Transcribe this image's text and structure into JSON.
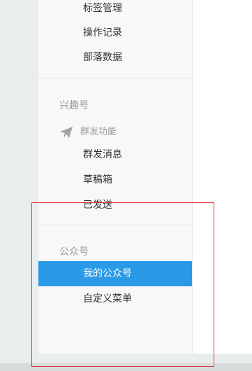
{
  "sidebar": {
    "top_items": [
      {
        "label": "标签管理"
      },
      {
        "label": "操作记录"
      },
      {
        "label": "部落数据"
      }
    ],
    "interest_section": {
      "title": "兴趣号",
      "subgroup": {
        "icon": "paper-plane-icon",
        "label": "群发功能"
      },
      "items": [
        {
          "label": "群发消息"
        },
        {
          "label": "草稿箱"
        },
        {
          "label": "已发送"
        }
      ]
    },
    "public_section": {
      "title": "公众号",
      "items": [
        {
          "label": "我的公众号",
          "active": true
        },
        {
          "label": "自定义菜单"
        }
      ]
    }
  },
  "colors": {
    "active_bg": "#2a99e6",
    "annotation_border": "#e0363c"
  }
}
